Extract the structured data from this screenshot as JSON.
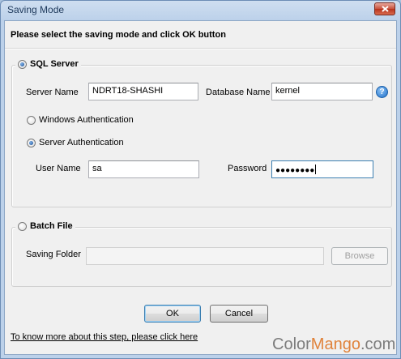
{
  "window": {
    "title": "Saving Mode"
  },
  "instruction": "Please select the saving mode and click OK button",
  "sql_server": {
    "label": "SQL Server",
    "selected": true,
    "server_name_label": "Server Name",
    "server_name_value": "NDRT18-SHASHI",
    "database_name_label": "Database Name",
    "database_name_value": "kernel",
    "help_icon": "?",
    "windows_auth_label": "Windows Authentication",
    "server_auth_label": "Server Authentication",
    "auth_mode": "server",
    "user_name_label": "User Name",
    "user_name_value": "sa",
    "password_label": "Password",
    "password_mask": "●●●●●●●●"
  },
  "batch_file": {
    "label": "Batch File",
    "selected": false,
    "saving_folder_label": "Saving Folder",
    "saving_folder_value": "",
    "browse_label": "Browse"
  },
  "buttons": {
    "ok": "OK",
    "cancel": "Cancel"
  },
  "help_link": "To know more about this step, please click here",
  "watermark": {
    "prefix": "Color",
    "brand": "Mango",
    "suffix": ".com"
  },
  "colors": {
    "title_text": "#1e395b",
    "accent": "#e0823a",
    "selection": "#1b4f93"
  }
}
